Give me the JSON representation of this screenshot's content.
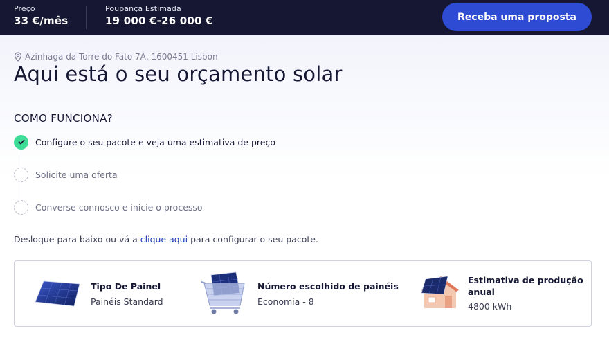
{
  "topbar": {
    "price_label": "Preço",
    "price_value": "33 €/mês",
    "savings_label": "Poupança Estimada",
    "savings_value": "19 000 €-26 000 €",
    "cta_label": "Receba uma proposta"
  },
  "address": {
    "icon": "location-pin-icon",
    "text": "Azinhaga da Torre do Fato 7A, 1600451 Lisbon"
  },
  "page_title": "Aqui está o seu orçamento solar",
  "how_it_works": {
    "heading": "COMO FUNCIONA?",
    "steps": [
      {
        "label": "Configure o seu pacote e veja uma estimativa de preço",
        "status": "done"
      },
      {
        "label": "Solicite uma oferta",
        "status": "pending"
      },
      {
        "label": "Converse connosco e inicie o processo",
        "status": "pending"
      }
    ]
  },
  "scroll_hint": {
    "before": "Desloque para baixo ou vá a ",
    "link": "clique aqui",
    "after": " para configurar o seu pacote."
  },
  "summary": {
    "panel_type": {
      "title": "Tipo De Painel",
      "value": "Painéis Standard",
      "icon": "solar-panel-icon"
    },
    "panel_count": {
      "title": "Número escolhido de painéis",
      "value": "Economia - 8",
      "icon": "shopping-cart-icon"
    },
    "production": {
      "title": "Estimativa de produção anual",
      "title_line1": "Estimativa de produção",
      "title_line2": "anual",
      "value": "4800 kWh",
      "icon": "house-icon"
    }
  },
  "colors": {
    "topbar_bg": "#161833",
    "cta_bg": "#2d4bd3",
    "step_done": "#3ddc97",
    "link": "#2037b8"
  }
}
